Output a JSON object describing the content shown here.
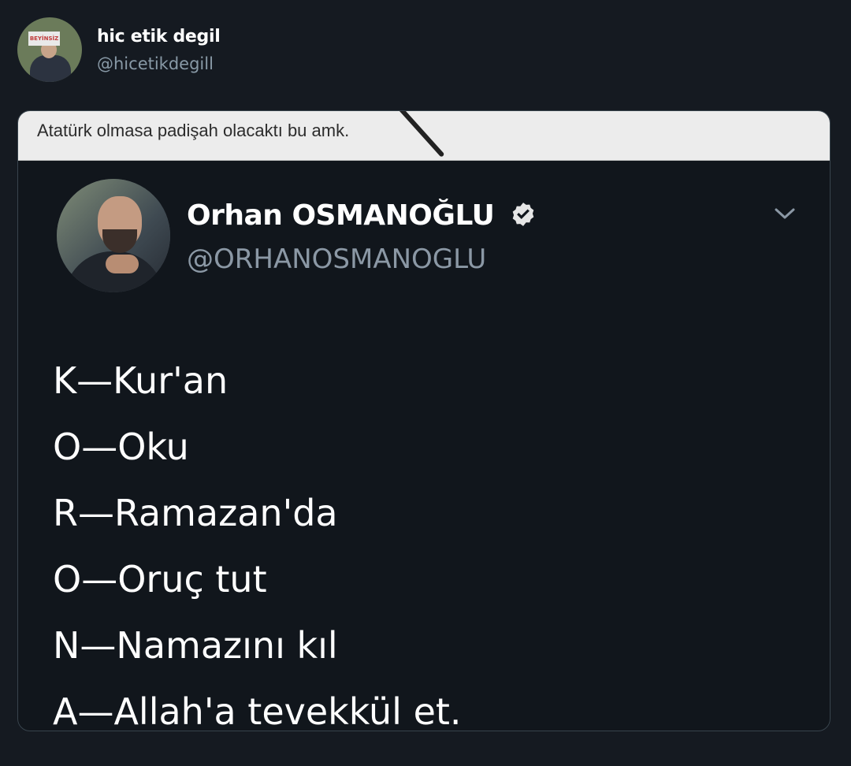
{
  "header": {
    "display_name": "hic etik degil",
    "handle": "@hicetikdegill",
    "avatar_sign": "BEYİNSİZ"
  },
  "quoted_caption": "Atatürk olmasa padişah olacaktı bu amk.",
  "inner_tweet": {
    "display_name": "Orhan OSMANOĞLU",
    "handle": "@ORHANOSMANOGLU",
    "verified": true,
    "lines": [
      "K—Kur'an",
      "O—Oku",
      "R—Ramazan'da",
      "O—Oruç tut",
      "N—Namazını kıl",
      "A—Allah'a tevekkül et."
    ]
  },
  "icons": {
    "verified": "verified-badge-icon",
    "menu": "chevron-down-icon"
  }
}
